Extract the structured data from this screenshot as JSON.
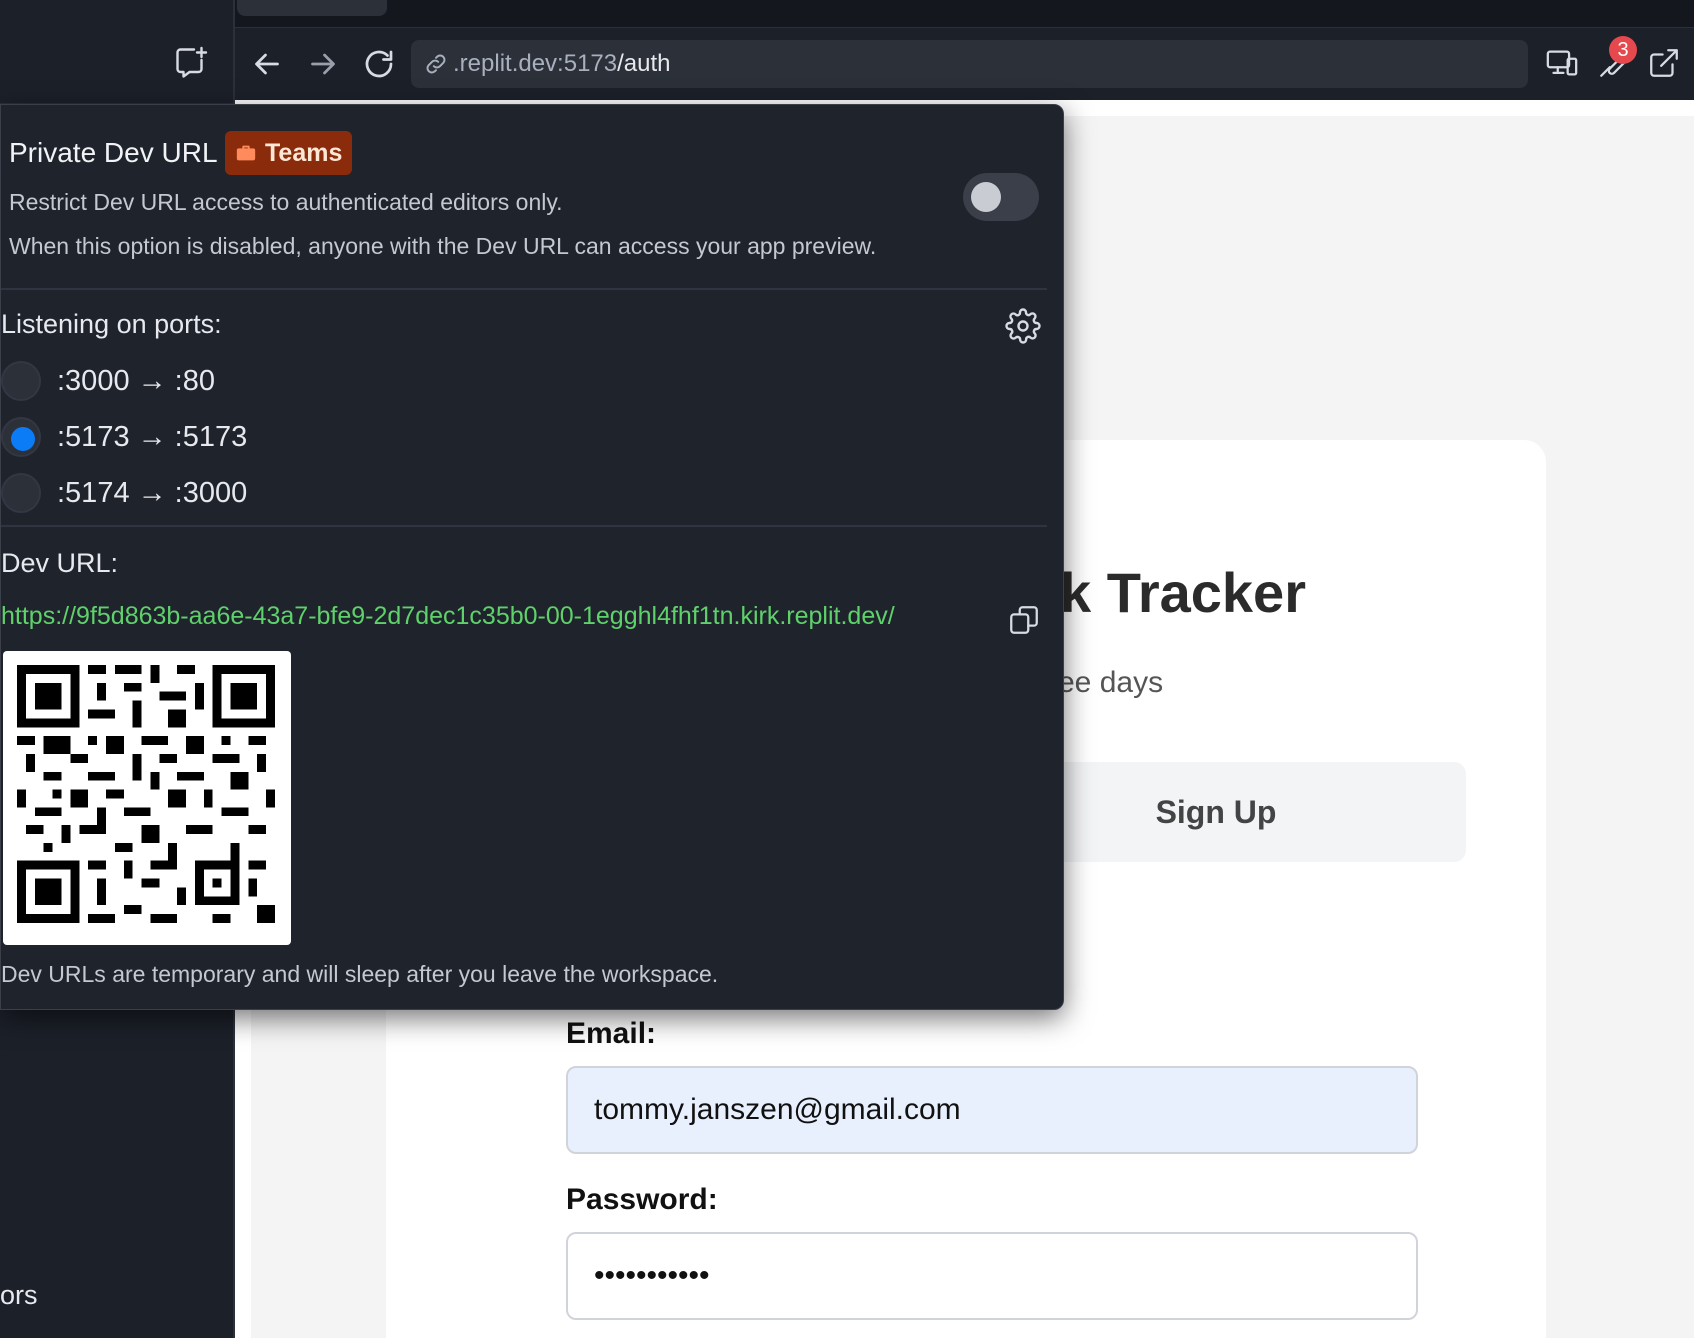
{
  "browser": {
    "url_host": ".replit.dev:5173",
    "url_path": "/auth",
    "notification_count": "3"
  },
  "sidebar": {
    "bottom_text": "ors"
  },
  "popover": {
    "title": "Private Dev URL",
    "teams_badge": "Teams",
    "restrict_text": "Restrict Dev URL access to authenticated editors only.",
    "disabled_note": "When this option is disabled, anyone with the Dev URL can access your app preview.",
    "toggle_on": false,
    "ports_label": "Listening on ports:",
    "ports": [
      {
        "label": ":3000 → :80",
        "selected": false
      },
      {
        "label": ":5173 → :5173",
        "selected": true
      },
      {
        "label": ":5174 → :3000",
        "selected": false
      }
    ],
    "dev_url_label": "Dev URL:",
    "dev_url": "https://9f5d863b-aa6e-43a7-bfe9-2d7dec1c35b0-00-1egghl4fhf1tn.kirk.replit.dev/",
    "footer": "Dev URLs are temporary and will sleep after you leave the workspace."
  },
  "app": {
    "title_visible": "k Tracker",
    "subtitle_visible": "ee days",
    "signup_tab": "Sign Up",
    "email_label": "Email:",
    "email_value": "tommy.janszen@gmail.com",
    "password_label": "Password:",
    "password_value": "•••••••••••"
  },
  "colors": {
    "panel_bg": "#1f232c",
    "accent_green": "#5fd16b",
    "radio_blue": "#0b7cf5",
    "teams_badge_bg": "#8a2c0c",
    "badge_red": "#e5484d"
  },
  "icons": [
    "new-chat-icon",
    "back-arrow-icon",
    "forward-arrow-icon",
    "reload-icon",
    "link-icon",
    "devices-icon",
    "wrench-icon",
    "external-link-icon",
    "briefcase-icon",
    "gear-icon",
    "copy-icon",
    "qr-code"
  ]
}
